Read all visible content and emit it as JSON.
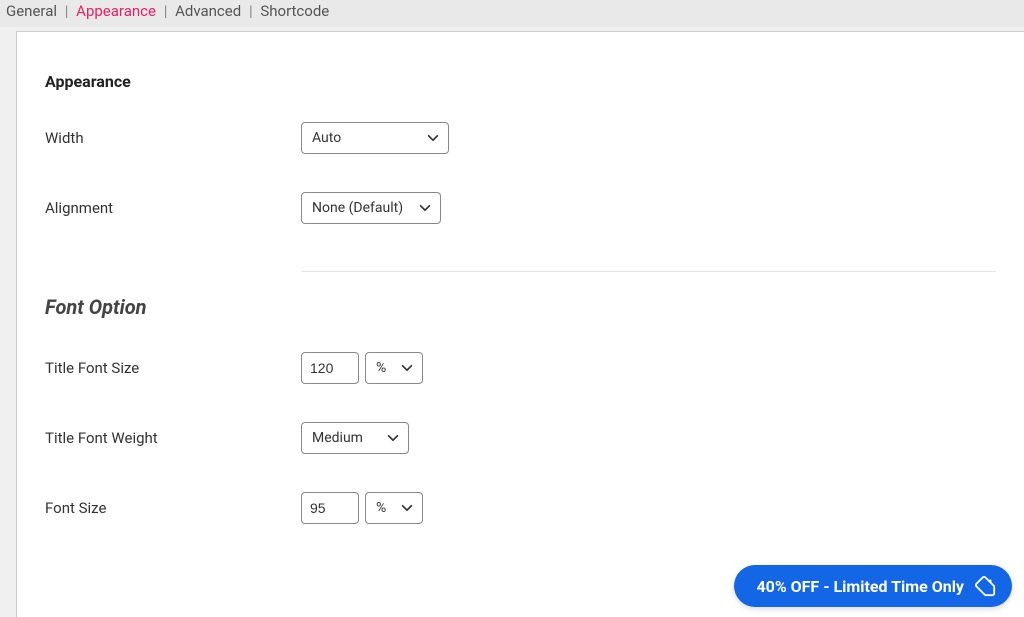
{
  "tabs": {
    "general": "General",
    "appearance": "Appearance",
    "advanced": "Advanced",
    "shortcode": "Shortcode",
    "active": "appearance"
  },
  "appearance": {
    "section_label": "Appearance",
    "width_label": "Width",
    "width_value": "Auto",
    "alignment_label": "Alignment",
    "alignment_value": "None (Default)"
  },
  "font_option": {
    "section_label": "Font Option",
    "title_font_size_label": "Title Font Size",
    "title_font_size_value": "120",
    "title_font_size_unit": "%",
    "title_font_weight_label": "Title Font Weight",
    "title_font_weight_value": "Medium",
    "font_size_label": "Font Size",
    "font_size_value": "95",
    "font_size_unit": "%"
  },
  "promo": {
    "text": "40% OFF - Limited Time Only"
  }
}
